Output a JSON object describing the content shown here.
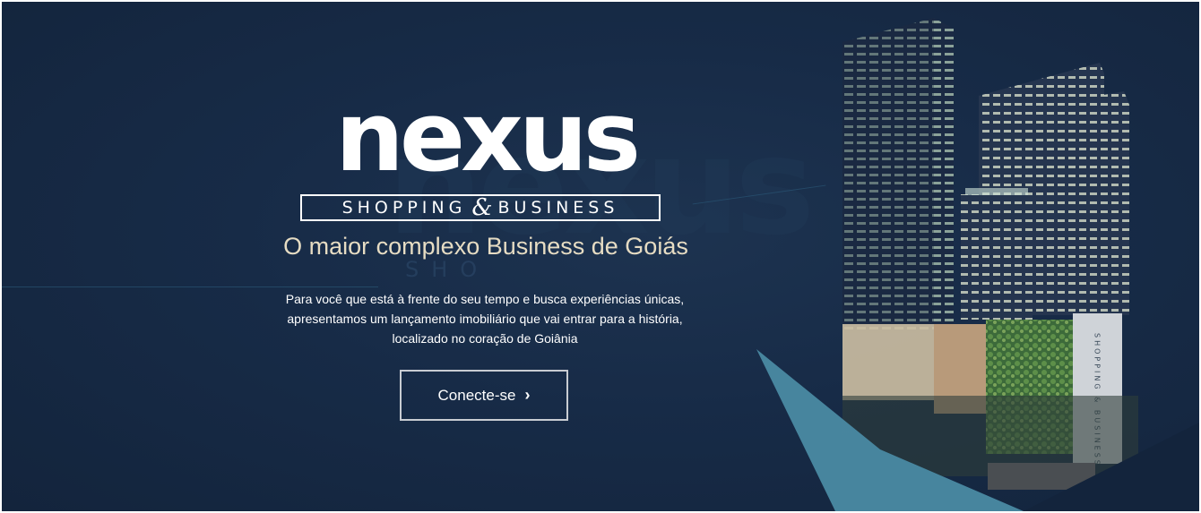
{
  "brand": {
    "logo_word": "nexus",
    "logo_sub_left": "SHOPPING",
    "logo_sub_amp": "&",
    "logo_sub_right": "BUSINESS"
  },
  "hero": {
    "tagline": "O maior complexo Business de Goiás",
    "description_lines": [
      "Para você que está à frente do seu tempo e busca experiências únicas,",
      "apresentamos um lançamento imobiliário que vai entrar para a história,",
      "localizado no coração de Goiânia"
    ],
    "cta_label": "Conecte-se",
    "cta_icon": "chevron-right-icon"
  },
  "illustration": {
    "building_sign_text": "SHOPPING & BUSINESS"
  },
  "colors": {
    "background": "#172b47",
    "accent_teal": "#4a8aa3",
    "tagline": "#e6dcc3",
    "text": "#ffffff"
  }
}
